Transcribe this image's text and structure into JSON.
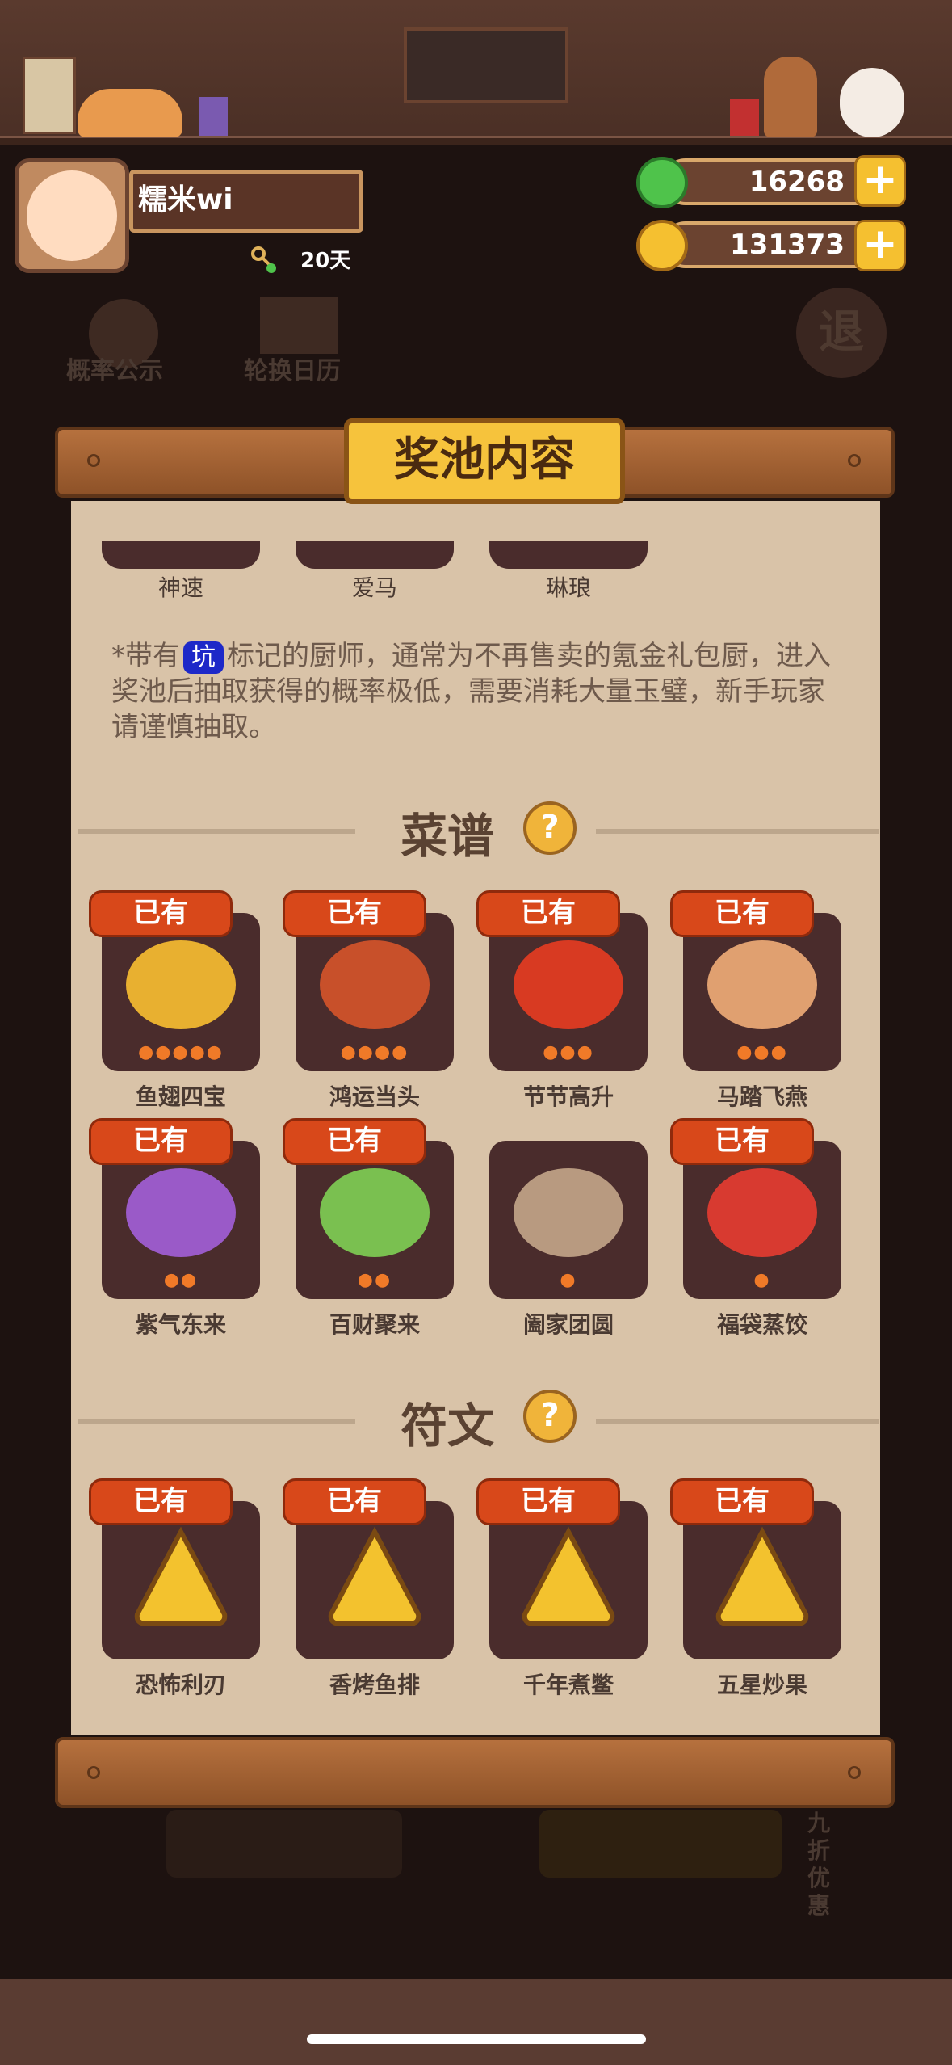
{
  "header": {
    "username": "糯米wi",
    "days": "20天",
    "gems": "16268",
    "coins": "131373"
  },
  "background_buttons": {
    "probability": "概率公示",
    "calendar": "轮换日历",
    "exit": "退"
  },
  "panel": {
    "title": "奖池内容",
    "chefs": [
      "神速",
      "爱马",
      "琳琅"
    ],
    "notice_prefix": "*带有",
    "notice_tag": "坑",
    "notice_suffix": "标记的厨师，通常为不再售卖的氪金礼包厨，进入奖池后抽取获得的概率极低，需要消耗大量玉璧，新手玩家请谨慎抽取。",
    "recipes_title": "菜谱",
    "runes_title": "符文",
    "owned_label": "已有",
    "recipes": [
      {
        "name": "鱼翅四宝",
        "owned": true,
        "stars": 5,
        "color": "#e8b030"
      },
      {
        "name": "鸿运当头",
        "owned": true,
        "stars": 4,
        "color": "#c8502a"
      },
      {
        "name": "节节高升",
        "owned": true,
        "stars": 3,
        "color": "#d83a22"
      },
      {
        "name": "马踏飞燕",
        "owned": true,
        "stars": 3,
        "color": "#e0a070"
      },
      {
        "name": "紫气东来",
        "owned": true,
        "stars": 2,
        "color": "#9a5ac8"
      },
      {
        "name": "百财聚来",
        "owned": true,
        "stars": 2,
        "color": "#7ac050"
      },
      {
        "name": "阖家团圆",
        "owned": false,
        "stars": 1,
        "color": "#b89a80"
      },
      {
        "name": "福袋蒸饺",
        "owned": true,
        "stars": 1,
        "color": "#d83a30"
      }
    ],
    "runes": [
      {
        "name": "恐怖利刃",
        "owned": true
      },
      {
        "name": "香烤鱼排",
        "owned": true
      },
      {
        "name": "千年煮鳖",
        "owned": true
      },
      {
        "name": "五星炒果",
        "owned": true
      }
    ]
  },
  "bottom_buttons": {
    "discount": "九折优惠"
  }
}
